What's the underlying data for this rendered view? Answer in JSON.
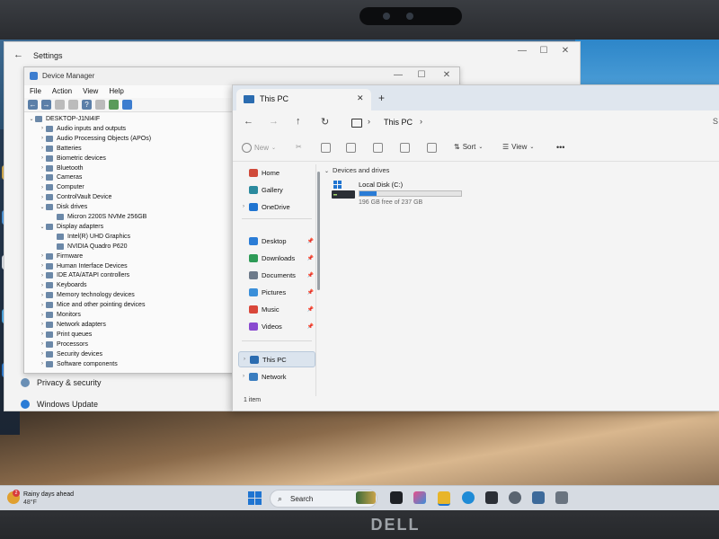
{
  "settings": {
    "title": "Settings",
    "nav_items": [
      "Privacy & security",
      "Windows Update"
    ]
  },
  "device_manager": {
    "title": "Device Manager",
    "menu": [
      "File",
      "Action",
      "View",
      "Help"
    ],
    "tree": [
      {
        "label": "DESKTOP-J1NI4IF",
        "level": 0,
        "chev": "⌄"
      },
      {
        "label": "Audio inputs and outputs",
        "level": 1,
        "chev": "›"
      },
      {
        "label": "Audio Processing Objects (APOs)",
        "level": 1,
        "chev": "›"
      },
      {
        "label": "Batteries",
        "level": 1,
        "chev": "›"
      },
      {
        "label": "Biometric devices",
        "level": 1,
        "chev": "›"
      },
      {
        "label": "Bluetooth",
        "level": 1,
        "chev": "›"
      },
      {
        "label": "Cameras",
        "level": 1,
        "chev": "›"
      },
      {
        "label": "Computer",
        "level": 1,
        "chev": "›"
      },
      {
        "label": "ControlVault Device",
        "level": 1,
        "chev": "›"
      },
      {
        "label": "Disk drives",
        "level": 1,
        "chev": "⌄"
      },
      {
        "label": "Micron 2200S NVMe 256GB",
        "level": 2,
        "chev": ""
      },
      {
        "label": "Display adapters",
        "level": 1,
        "chev": "⌄"
      },
      {
        "label": "Intel(R) UHD Graphics",
        "level": 2,
        "chev": ""
      },
      {
        "label": "NVIDIA Quadro P620",
        "level": 2,
        "chev": ""
      },
      {
        "label": "Firmware",
        "level": 1,
        "chev": "›"
      },
      {
        "label": "Human Interface Devices",
        "level": 1,
        "chev": "›"
      },
      {
        "label": "IDE ATA/ATAPI controllers",
        "level": 1,
        "chev": "›"
      },
      {
        "label": "Keyboards",
        "level": 1,
        "chev": "›"
      },
      {
        "label": "Memory technology devices",
        "level": 1,
        "chev": "›"
      },
      {
        "label": "Mice and other pointing devices",
        "level": 1,
        "chev": "›"
      },
      {
        "label": "Monitors",
        "level": 1,
        "chev": "›"
      },
      {
        "label": "Network adapters",
        "level": 1,
        "chev": "›"
      },
      {
        "label": "Print queues",
        "level": 1,
        "chev": "›"
      },
      {
        "label": "Processors",
        "level": 1,
        "chev": "›"
      },
      {
        "label": "Security devices",
        "level": 1,
        "chev": "›"
      },
      {
        "label": "Software components",
        "level": 1,
        "chev": "›"
      }
    ]
  },
  "explorer": {
    "tab_title": "This PC",
    "address": "This PC",
    "commands": {
      "new": "New",
      "sort": "Sort",
      "view": "View",
      "more": "•••"
    },
    "sidebar": [
      {
        "label": "Home",
        "icon": "home-icon",
        "color": "#d04a3a",
        "pin": false,
        "chev": false
      },
      {
        "label": "Gallery",
        "icon": "gallery-icon",
        "color": "#2b8a9e",
        "pin": false,
        "chev": false
      },
      {
        "label": "OneDrive",
        "icon": "cloud-icon",
        "color": "#1f74d1",
        "pin": false,
        "chev": true
      },
      {
        "label": "Desktop",
        "icon": "desktop-icon",
        "color": "#2a7cd6",
        "pin": true,
        "chev": false
      },
      {
        "label": "Downloads",
        "icon": "download-icon",
        "color": "#2e9b57",
        "pin": true,
        "chev": false
      },
      {
        "label": "Documents",
        "icon": "document-icon",
        "color": "#6d7a8a",
        "pin": true,
        "chev": false
      },
      {
        "label": "Pictures",
        "icon": "picture-icon",
        "color": "#3a8fd9",
        "pin": true,
        "chev": false
      },
      {
        "label": "Music",
        "icon": "music-icon",
        "color": "#d9473a",
        "pin": true,
        "chev": false
      },
      {
        "label": "Videos",
        "icon": "video-icon",
        "color": "#8a4ad0",
        "pin": true,
        "chev": false
      },
      {
        "label": "This PC",
        "icon": "computer-icon",
        "color": "#2b6cb0",
        "pin": false,
        "chev": true,
        "selected": true
      },
      {
        "label": "Network",
        "icon": "network-icon",
        "color": "#3a7dbf",
        "pin": false,
        "chev": true
      }
    ],
    "section_title": "Devices and drives",
    "drive": {
      "label": "Local Disk (C:)",
      "free_text": "196 GB free of 237 GB",
      "used_fraction": 0.17
    },
    "status": "1 item"
  },
  "taskbar": {
    "weather_text": "Rainy days ahead",
    "weather_temp": "48°F",
    "weather_badge": "2",
    "search_placeholder": "Search"
  },
  "brand": "DELL",
  "colors": {
    "accent": "#1f74d1",
    "drive_fill": "#2a7cd6"
  }
}
